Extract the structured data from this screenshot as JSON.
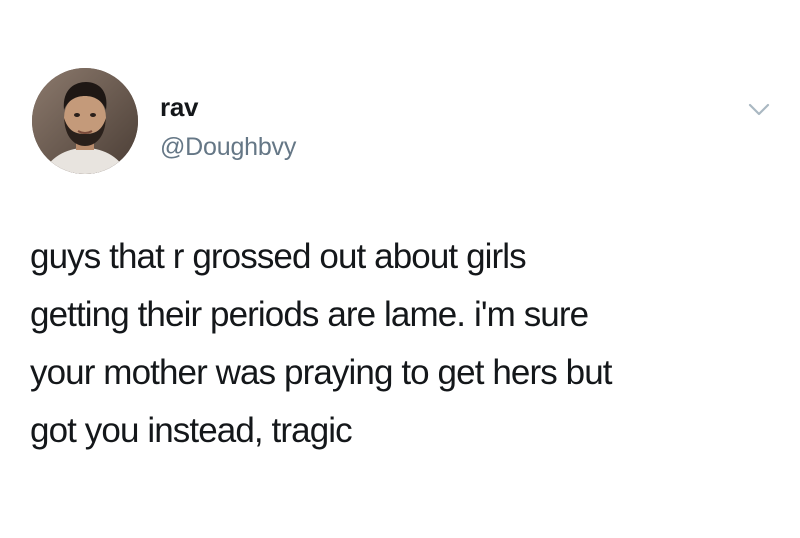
{
  "tweet": {
    "author": {
      "display_name": "rav",
      "handle": "@Doughbvy"
    },
    "menu_icon": "chevron-down-icon",
    "text_lines": [
      "guys that r grossed out about girls",
      "getting their periods are lame. i'm sure",
      "your mother was praying to get hers but",
      "got you instead, tragic"
    ]
  },
  "colors": {
    "text": "#14171a",
    "handle": "#657786",
    "chevron": "#aab8c2"
  }
}
